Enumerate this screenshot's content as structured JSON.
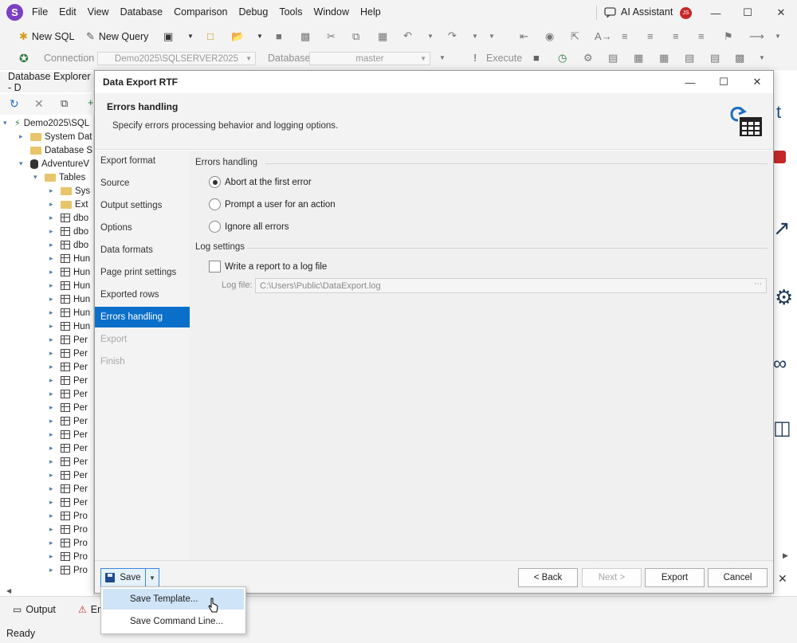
{
  "app": {
    "logo_letter": "S"
  },
  "menu": [
    "File",
    "Edit",
    "View",
    "Database",
    "Comparison",
    "Debug",
    "Tools",
    "Window",
    "Help"
  ],
  "ai_assistant": "AI Assistant",
  "user_initials": "JS",
  "toolbar": {
    "new_sql": "New SQL",
    "new_query": "New Query",
    "connection_label": "Connection",
    "connection_value": "Demo2025\\SQLSERVER2025",
    "database_label": "Database",
    "database_value": "master",
    "execute": "Execute"
  },
  "explorer": {
    "title": "Database Explorer - D",
    "rows": [
      {
        "label": "Demo2025\\SQL",
        "icon": "server",
        "level": 0
      },
      {
        "label": "System Dat",
        "icon": "folder",
        "level": 1
      },
      {
        "label": "Database S",
        "icon": "folder",
        "level": 1
      },
      {
        "label": "AdventureV",
        "icon": "db",
        "level": 1
      },
      {
        "label": "Tables",
        "icon": "folder",
        "level": 2
      },
      {
        "label": "Sys",
        "icon": "folder",
        "level": 3
      },
      {
        "label": "Ext",
        "icon": "folder",
        "level": 3
      },
      {
        "label": "dbo",
        "icon": "table",
        "level": 3
      },
      {
        "label": "dbo",
        "icon": "table",
        "level": 3
      },
      {
        "label": "dbo",
        "icon": "table",
        "level": 3
      },
      {
        "label": "Hun",
        "icon": "table",
        "level": 3
      },
      {
        "label": "Hun",
        "icon": "table",
        "level": 3
      },
      {
        "label": "Hun",
        "icon": "table",
        "level": 3
      },
      {
        "label": "Hun",
        "icon": "table",
        "level": 3
      },
      {
        "label": "Hun",
        "icon": "table",
        "level": 3
      },
      {
        "label": "Hun",
        "icon": "table",
        "level": 3
      },
      {
        "label": "Per",
        "icon": "table",
        "level": 3
      },
      {
        "label": "Per",
        "icon": "table",
        "level": 3
      },
      {
        "label": "Per",
        "icon": "table",
        "level": 3
      },
      {
        "label": "Per",
        "icon": "table",
        "level": 3
      },
      {
        "label": "Per",
        "icon": "table",
        "level": 3
      },
      {
        "label": "Per",
        "icon": "table",
        "level": 3
      },
      {
        "label": "Per",
        "icon": "table",
        "level": 3
      },
      {
        "label": "Per",
        "icon": "table",
        "level": 3
      },
      {
        "label": "Per",
        "icon": "table",
        "level": 3
      },
      {
        "label": "Per",
        "icon": "table",
        "level": 3
      },
      {
        "label": "Per",
        "icon": "table",
        "level": 3
      },
      {
        "label": "Per",
        "icon": "table",
        "level": 3
      },
      {
        "label": "Per",
        "icon": "table",
        "level": 3
      },
      {
        "label": "Pro",
        "icon": "table",
        "level": 3
      },
      {
        "label": "Pro",
        "icon": "table",
        "level": 3
      },
      {
        "label": "Pro",
        "icon": "table",
        "level": 3
      },
      {
        "label": "Pro",
        "icon": "table",
        "level": 3
      },
      {
        "label": "Pro",
        "icon": "table",
        "level": 3
      }
    ]
  },
  "bottom_tabs": {
    "output": "Output",
    "error": "Er"
  },
  "status": "Ready",
  "dialog": {
    "title": "Data Export RTF",
    "heading": "Errors handling",
    "description": "Specify errors processing behavior and logging options.",
    "nav": [
      {
        "label": "Export format",
        "state": "normal"
      },
      {
        "label": "Source",
        "state": "normal"
      },
      {
        "label": "Output settings",
        "state": "normal"
      },
      {
        "label": "Options",
        "state": "normal"
      },
      {
        "label": "Data formats",
        "state": "normal"
      },
      {
        "label": "Page print settings",
        "state": "normal"
      },
      {
        "label": "Exported rows",
        "state": "normal"
      },
      {
        "label": "Errors handling",
        "state": "active"
      },
      {
        "label": "Export",
        "state": "disabled"
      },
      {
        "label": "Finish",
        "state": "disabled"
      }
    ],
    "errors_group": "Errors handling",
    "radios": [
      {
        "label": "Abort at the first error",
        "checked": true
      },
      {
        "label": "Prompt a user for an action",
        "checked": false
      },
      {
        "label": "Ignore all errors",
        "checked": false
      }
    ],
    "log_group": "Log settings",
    "write_log": "Write a report to a log file",
    "log_file_label": "Log file:",
    "log_file_value": "C:\\Users\\Public\\DataExport.log",
    "buttons": {
      "save": "Save",
      "back": "< Back",
      "next": "Next >",
      "export": "Export",
      "cancel": "Cancel"
    }
  },
  "popup": {
    "save_template": "Save Template...",
    "save_command_line": "Save Command Line..."
  }
}
